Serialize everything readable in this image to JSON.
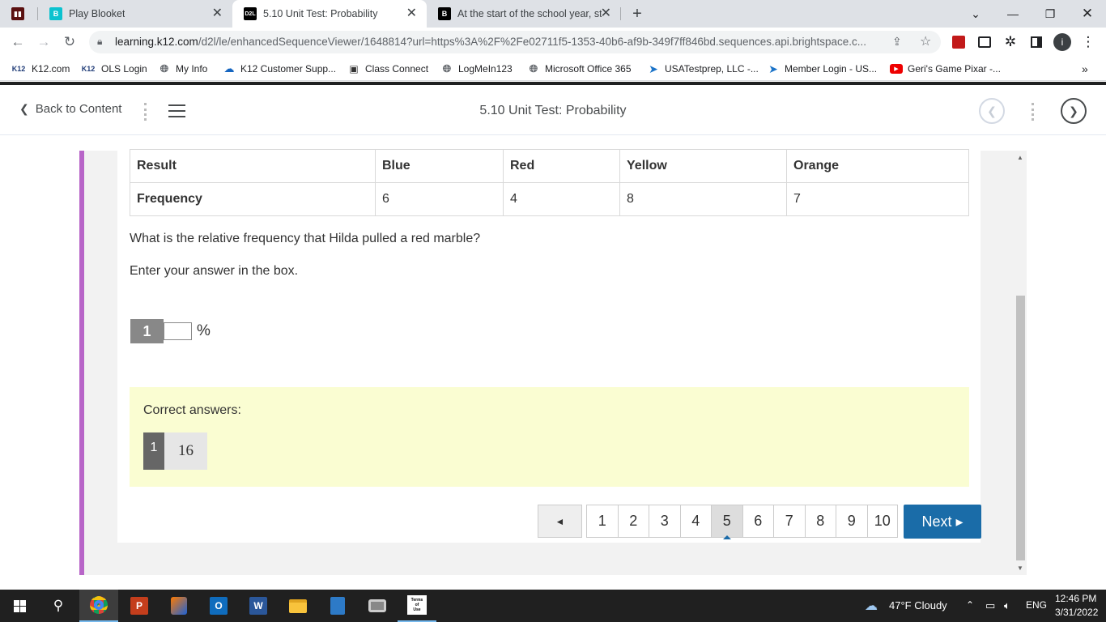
{
  "browser": {
    "tabs": [
      {
        "title": "",
        "icon": "im-icon",
        "icon_color": "#000000"
      },
      {
        "title": "Play Blooket",
        "icon": "blooket-icon",
        "icon_color": "#0bc2cf"
      },
      {
        "title": "5.10 Unit Test: Probability",
        "icon": "d2l-icon",
        "icon_color": "#000000"
      },
      {
        "title": "At the start of the school year, stu",
        "icon": "brainly-icon",
        "icon_color": "#000000"
      }
    ],
    "url_host": "learning.k12.com",
    "url_path": "/d2l/le/enhancedSequenceViewer/1648814?url=https%3A%2F%2Fe02711f5-1353-40b6-af9b-349f7ff846bd.sequences.api.brightspace.c...",
    "bookmarks": [
      {
        "label": "K12.com",
        "icon": "K12"
      },
      {
        "label": "OLS Login",
        "icon": "K12"
      },
      {
        "label": "My Info",
        "icon": "globe"
      },
      {
        "label": "K12 Customer Supp...",
        "icon": "cloud"
      },
      {
        "label": "Class Connect",
        "icon": "camera"
      },
      {
        "label": "LogMeIn123",
        "icon": "globe"
      },
      {
        "label": "Microsoft Office 365",
        "icon": "globe"
      },
      {
        "label": "USATestprep, LLC -...",
        "icon": "cursor"
      },
      {
        "label": "Member Login - US...",
        "icon": "cursor"
      },
      {
        "label": "Geri's Game Pixar -...",
        "icon": "youtube"
      }
    ]
  },
  "d2l": {
    "back_label": "Back to Content",
    "title": "5.10 Unit Test: Probability"
  },
  "question": {
    "table": {
      "headers": [
        "Result",
        "Blue",
        "Red",
        "Yellow",
        "Orange"
      ],
      "row_label": "Frequency",
      "values": [
        "6",
        "4",
        "8",
        "7"
      ]
    },
    "prompt": "What is the relative frequency that Hilda pulled a red marble?",
    "instruction": "Enter your answer in the box.",
    "answer_number": "1",
    "answer_value": "",
    "answer_unit": "%",
    "correct_label": "Correct answers:",
    "correct_number": "1",
    "correct_value": "16"
  },
  "pager": {
    "prev": "◄",
    "pages": [
      "1",
      "2",
      "3",
      "4",
      "5",
      "6",
      "7",
      "8",
      "9",
      "10"
    ],
    "current": "5",
    "next": "Next ▸"
  },
  "taskbar": {
    "weather": "47°F  Cloudy",
    "lang": "ENG",
    "time": "12:46 PM",
    "date": "3/31/2022"
  }
}
